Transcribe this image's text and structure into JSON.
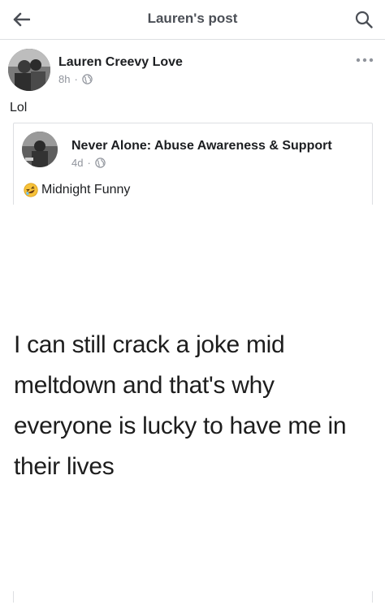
{
  "topbar": {
    "title": "Lauren's post",
    "back_icon": "arrow-left-icon",
    "search_icon": "search-icon"
  },
  "post": {
    "author": "Lauren Creevy Love",
    "time": "8h",
    "separator": "·",
    "privacy_icon": "globe-icon",
    "text": "Lol"
  },
  "shared": {
    "author": "Never Alone: Abuse Awareness & Support",
    "time": "4d",
    "separator": "·",
    "privacy_icon": "globe-icon",
    "caption_emoji": "rolling-on-floor-laughing-emoji",
    "caption": "Midnight Funny",
    "meme_lines": [
      "I can still crack a joke mid",
      "meltdown and that's why",
      "everyone is lucky to have me in",
      "their lives"
    ]
  },
  "colors": {
    "title_gray": "#4b4f56",
    "meta_gray": "#90949c",
    "divider": "#dddfe2",
    "text": "#1c1e21"
  }
}
